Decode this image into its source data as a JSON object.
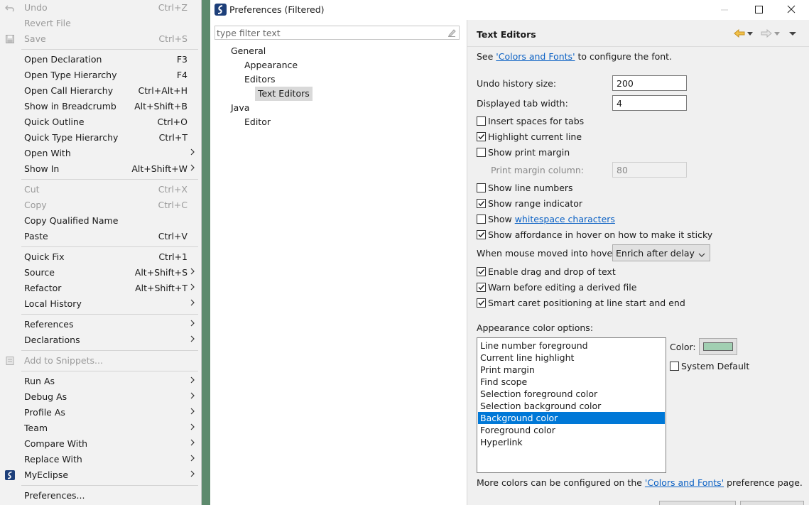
{
  "menu": {
    "items": [
      {
        "label": "Undo",
        "shortcut": "Ctrl+Z",
        "disabled": true,
        "icon": "undo-icon"
      },
      {
        "label": "Revert File",
        "shortcut": "",
        "disabled": true
      },
      {
        "label": "Save",
        "shortcut": "Ctrl+S",
        "disabled": true,
        "icon": "save-icon"
      },
      {
        "label": "Open Declaration",
        "shortcut": "F3"
      },
      {
        "label": "Open Type Hierarchy",
        "shortcut": "F4"
      },
      {
        "label": "Open Call Hierarchy",
        "shortcut": "Ctrl+Alt+H"
      },
      {
        "label": "Show in Breadcrumb",
        "shortcut": "Alt+Shift+B"
      },
      {
        "label": "Quick Outline",
        "shortcut": "Ctrl+O"
      },
      {
        "label": "Quick Type Hierarchy",
        "shortcut": "Ctrl+T"
      },
      {
        "label": "Open With",
        "shortcut": "",
        "submenu": true
      },
      {
        "label": "Show In",
        "shortcut": "Alt+Shift+W",
        "submenu": true
      },
      {
        "label": "Cut",
        "shortcut": "Ctrl+X",
        "disabled": true
      },
      {
        "label": "Copy",
        "shortcut": "Ctrl+C",
        "disabled": true
      },
      {
        "label": "Copy Qualified Name",
        "shortcut": ""
      },
      {
        "label": "Paste",
        "shortcut": "Ctrl+V"
      },
      {
        "label": "Quick Fix",
        "shortcut": "Ctrl+1"
      },
      {
        "label": "Source",
        "shortcut": "Alt+Shift+S",
        "submenu": true
      },
      {
        "label": "Refactor",
        "shortcut": "Alt+Shift+T",
        "submenu": true
      },
      {
        "label": "Local History",
        "shortcut": "",
        "submenu": true
      },
      {
        "label": "References",
        "shortcut": "",
        "submenu": true
      },
      {
        "label": "Declarations",
        "shortcut": "",
        "submenu": true
      },
      {
        "label": "Add to Snippets...",
        "shortcut": "",
        "disabled": true,
        "icon": "snippet-icon"
      },
      {
        "label": "Run As",
        "shortcut": "",
        "submenu": true
      },
      {
        "label": "Debug As",
        "shortcut": "",
        "submenu": true
      },
      {
        "label": "Profile As",
        "shortcut": "",
        "submenu": true
      },
      {
        "label": "Team",
        "shortcut": "",
        "submenu": true
      },
      {
        "label": "Compare With",
        "shortcut": "",
        "submenu": true
      },
      {
        "label": "Replace With",
        "shortcut": "",
        "submenu": true
      },
      {
        "label": "MyEclipse",
        "shortcut": "",
        "submenu": true,
        "icon": "myeclipse-icon"
      },
      {
        "label": "Preferences...",
        "shortcut": ""
      }
    ]
  },
  "dialog": {
    "title": "Preferences (Filtered)",
    "icon": "myeclipse-icon"
  },
  "filter": {
    "placeholder": "type filter text",
    "value": ""
  },
  "tree": [
    {
      "label": "General",
      "level": 0
    },
    {
      "label": "Appearance",
      "level": 1
    },
    {
      "label": "Editors",
      "level": 1
    },
    {
      "label": "Text Editors",
      "level": 2,
      "selected": true
    },
    {
      "label": "Java",
      "level": 0
    },
    {
      "label": "Editor",
      "level": 1
    }
  ],
  "page": {
    "title": "Text Editors",
    "see_prefix": "See ",
    "see_link": "'Colors and Fonts'",
    "see_suffix": " to configure the font.",
    "undo_label": "Undo history size:",
    "undo_value": "200",
    "tab_label": "Displayed tab width:",
    "tab_value": "4",
    "cb_insert_spaces": "Insert spaces for tabs",
    "cb_highlight_line": "Highlight current line",
    "cb_print_margin": "Show print margin",
    "print_margin_label": "Print margin column:",
    "print_margin_value": "80",
    "cb_line_numbers": "Show line numbers",
    "cb_range_indicator": "Show range indicator",
    "cb_whitespace_prefix": "Show ",
    "cb_whitespace_link": "whitespace characters",
    "cb_affordance": "Show affordance in hover on how to make it sticky",
    "hover_label": "When mouse moved into hover:",
    "hover_value": "Enrich after delay",
    "cb_drag_drop": "Enable drag and drop of text",
    "cb_warn_derived": "Warn before editing a derived file",
    "cb_smart_caret": "Smart caret positioning at line start and end",
    "color_options_label": "Appearance color options:",
    "color_items": [
      "Line number foreground",
      "Current line highlight",
      "Print margin",
      "Find scope",
      "Selection foreground color",
      "Selection background color",
      "Background color",
      "Foreground color",
      "Hyperlink"
    ],
    "selected_color_item": "Background color",
    "color_label": "Color:",
    "color_value": "#a1cfb2",
    "system_default_label": "System Default",
    "more_prefix": "More colors can be configured on the ",
    "more_link": "'Colors and Fonts'",
    "more_suffix": " preference page."
  },
  "checkbox_states": {
    "insert_spaces": false,
    "highlight_line": true,
    "print_margin": false,
    "line_numbers": false,
    "range_indicator": true,
    "whitespace": false,
    "affordance": true,
    "drag_drop": true,
    "warn_derived": true,
    "smart_caret": true,
    "system_default": false
  },
  "colors": {
    "selection": "#0078d7",
    "link": "#0b61c4",
    "editor_bg_peek": "#5d8a6d"
  }
}
